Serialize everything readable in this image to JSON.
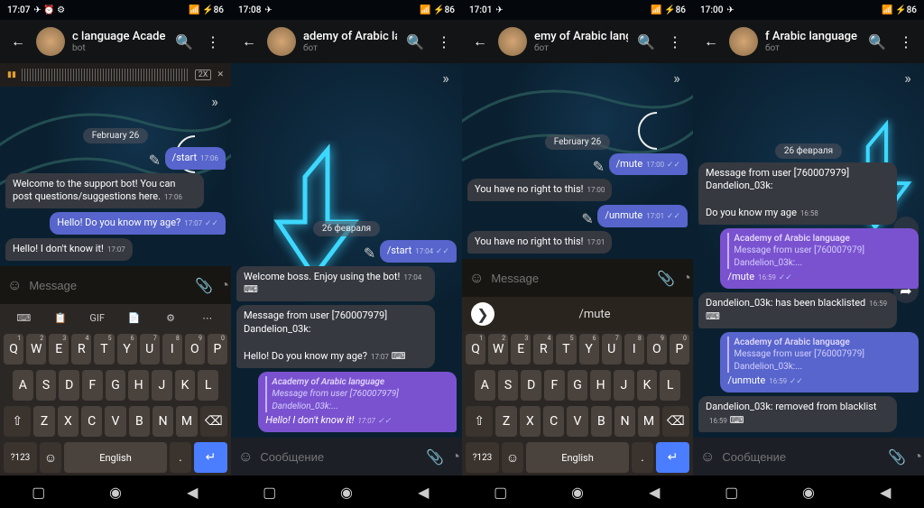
{
  "panels": [
    {
      "status": {
        "time": "17:07",
        "icons": "✈ ⏰ ⚙",
        "right": "📶 ⚡86"
      },
      "header": {
        "title": "c language   Academy",
        "subtitle": "bot"
      },
      "date": "February 26",
      "audio_speed": "2X",
      "messages": [
        {
          "side": "out",
          "text": "/start",
          "time": "17:06",
          "edited": true
        },
        {
          "side": "in",
          "text": "Welcome to the support bot! You can post questions/suggestions here.",
          "time": "17:06"
        },
        {
          "side": "out",
          "text": "Hello! Do you know my age?",
          "time": "17:07"
        },
        {
          "side": "in",
          "text": "Hello! I don't know it!",
          "time": "17:07"
        }
      ],
      "input": {
        "placeholder": "Message"
      }
    },
    {
      "status": {
        "time": "17:08",
        "icons": "✈",
        "right": "📶 ⚡86"
      },
      "header": {
        "title": "ademy of Arabic lang...",
        "subtitle": "бот"
      },
      "date": "26 февраля",
      "messages": [
        {
          "side": "out",
          "text": "/start",
          "time": "17:04",
          "edited": true
        },
        {
          "side": "in",
          "text": "Welcome boss. Enjoy using the bot!",
          "time": "17:04"
        },
        {
          "side": "in",
          "text": "Message from user [760007979] Dandelion_03k:\n\nHello! Do you know my age?",
          "time": "17:07"
        },
        {
          "side": "out",
          "reply": {
            "r1": "Academy of Arabic language",
            "r2": "Message from user [760007979] Dandelion_03k:..."
          },
          "text": "Hello! I don't know it!",
          "time": "17:07",
          "italic": true,
          "purple": true
        }
      ],
      "input": {
        "placeholder": "Сообщение"
      }
    },
    {
      "status": {
        "time": "17:01",
        "icons": "✈",
        "right": "📶 ⚡86"
      },
      "header": {
        "title": "emy of Arabic langua...",
        "subtitle": "бот"
      },
      "date": "February 26",
      "messages": [
        {
          "side": "out",
          "text": "/mute",
          "time": "17:00",
          "edited": true
        },
        {
          "side": "in",
          "text": "You have no right to this!",
          "time": "17:00"
        },
        {
          "side": "out",
          "text": "/unmute",
          "time": "17:01",
          "edited": true
        },
        {
          "side": "in",
          "text": "You have no right to this!",
          "time": "17:01"
        }
      ],
      "input": {
        "placeholder": "Message"
      },
      "suggest": "/mute"
    },
    {
      "status": {
        "time": "17:00",
        "icons": "✈",
        "right": "📶 ⚡86"
      },
      "header": {
        "title": "f Arabic language   Ac...",
        "subtitle": "бот"
      },
      "date": "26 февраля",
      "messages": [
        {
          "side": "in",
          "text": "Message from user [760007979] Dandelion_03k:\n\nDo you know my age",
          "time": "16:58"
        },
        {
          "side": "out",
          "reply": {
            "r1": "Academy of Arabic language",
            "r2": "Message from user [760007979] Dandelion_03k:..."
          },
          "text": "/mute",
          "time": "16:59",
          "purple": true
        },
        {
          "side": "in",
          "text": "Dandelion_03k: has been blacklisted",
          "time": "16:59"
        },
        {
          "side": "out",
          "reply": {
            "r1": "Academy of Arabic language",
            "r2": "Message from user [760007979] Dandelion_03k:..."
          },
          "text": "/unmute",
          "time": "16:59"
        },
        {
          "side": "in",
          "text": "Dandelion_03k: removed from blacklist",
          "time": "16:59"
        }
      ],
      "input": {
        "placeholder": "Сообщение"
      }
    }
  ],
  "keyboard": {
    "top": [
      "⌨",
      "📋",
      "GIF",
      "📄",
      "⚙",
      "⋯"
    ],
    "r1": [
      [
        "Q",
        "1"
      ],
      [
        "W",
        "2"
      ],
      [
        "E",
        "3"
      ],
      [
        "R",
        "4"
      ],
      [
        "T",
        "5"
      ],
      [
        "Y",
        "6"
      ],
      [
        "U",
        "7"
      ],
      [
        "I",
        "8"
      ],
      [
        "O",
        "9"
      ],
      [
        "P",
        "0"
      ]
    ],
    "r2": [
      "A",
      "S",
      "D",
      "F",
      "G",
      "H",
      "J",
      "K",
      "L"
    ],
    "r3": [
      "Z",
      "X",
      "C",
      "V",
      "B",
      "N",
      "M"
    ],
    "shift": "⇧",
    "bksp": "⌫",
    "numkey": "?123",
    "emoji": "☺",
    "space": "English",
    "enter": "↵"
  }
}
